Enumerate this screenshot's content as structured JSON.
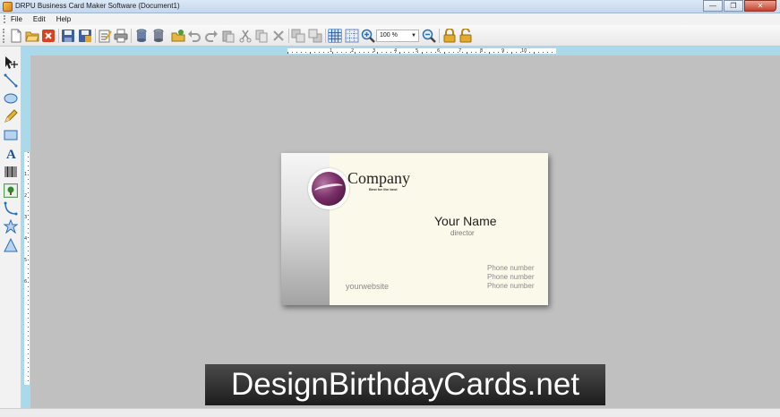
{
  "window": {
    "title": "DRPU Business Card Maker Software  (Document1)",
    "minimize_glyph": "—",
    "restore_glyph": "❐",
    "close_glyph": "✕"
  },
  "menu": {
    "items": [
      "File",
      "Edit",
      "Help"
    ]
  },
  "toolbar": {
    "zoom_value": "100 %",
    "buttons": [
      "new-icon",
      "open-icon",
      "close-doc-icon",
      "save-icon",
      "save-as-icon",
      "properties-icon",
      "print-icon",
      "database-icon",
      "database-export-icon",
      "open-folder-icon",
      "undo-icon",
      "redo-icon",
      "paste-icon",
      "cut-icon",
      "copy-icon",
      "delete-icon",
      "bring-front-icon",
      "send-back-icon",
      "grid-icon",
      "snap-icon",
      "zoom-in-icon",
      "zoom-out-icon",
      "lock-icon",
      "unlock-icon"
    ]
  },
  "tools": [
    "pointer-move-icon",
    "line-icon",
    "ellipse-icon",
    "pencil-icon",
    "rectangle-icon",
    "text-icon",
    "barcode-icon",
    "image-icon",
    "curve-icon",
    "star-icon",
    "triangle-icon"
  ],
  "ruler": {
    "h_labels": [
      "1",
      "2",
      "3",
      "4",
      "5",
      "6",
      "7",
      "8",
      "9",
      "10"
    ],
    "v_labels": [
      "1",
      "2",
      "3",
      "4",
      "5",
      "6"
    ]
  },
  "card": {
    "company": "Company",
    "tagline": "Best for the best",
    "name": "Your Name",
    "title": "director",
    "phones": [
      "Phone number",
      "Phone number",
      "Phone number"
    ],
    "website": "yourwebsite",
    "colors": {
      "background": "#fbf9ea",
      "logo": "#7a2f68",
      "band": "#a3a3a3"
    }
  },
  "watermark": {
    "text": "DesignBirthdayCards.net"
  }
}
